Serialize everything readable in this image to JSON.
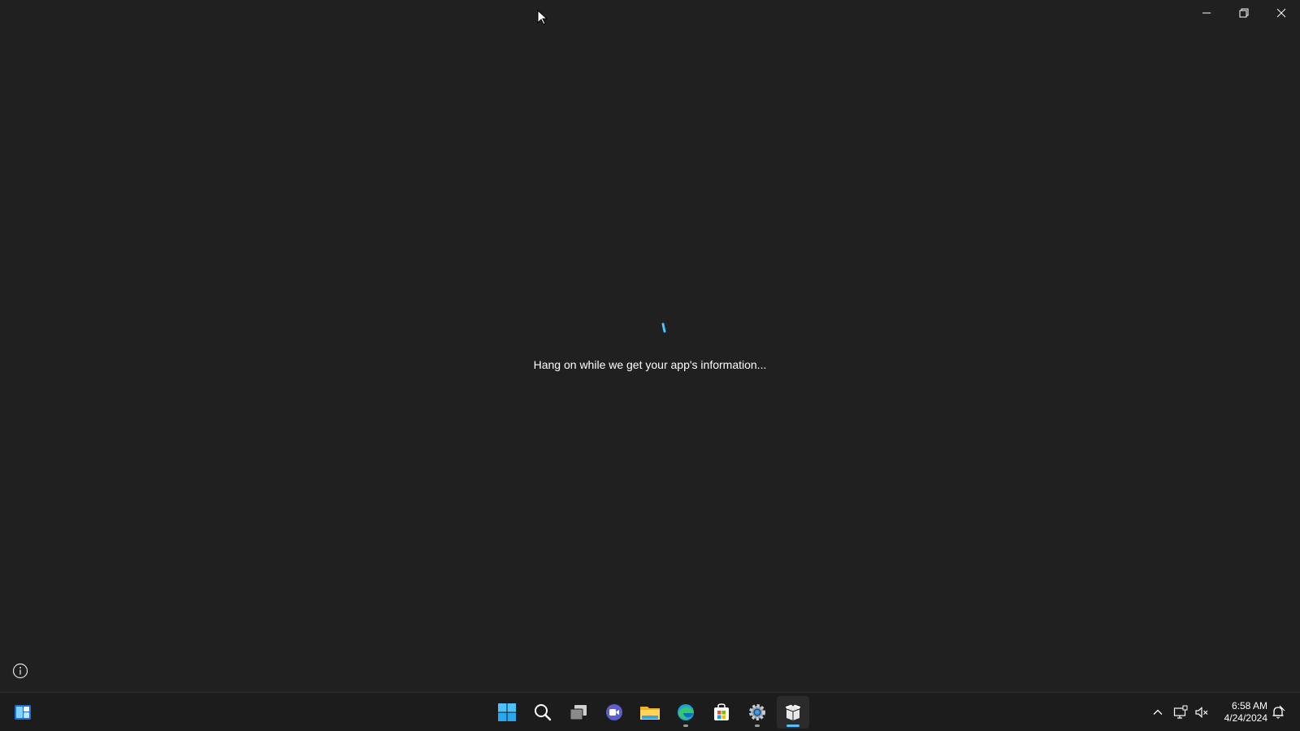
{
  "window": {
    "loading_message": "Hang on while we get your app's information...",
    "controls": [
      "minimize-icon",
      "restore-icon",
      "close-icon"
    ]
  },
  "taskbar": {
    "widgets_icon": "widgets-icon",
    "pinned": [
      {
        "name": "start",
        "icon": "windows-logo-icon",
        "running": false
      },
      {
        "name": "search",
        "icon": "search-icon",
        "running": false
      },
      {
        "name": "task-view",
        "icon": "task-view-icon",
        "running": false
      },
      {
        "name": "chat",
        "icon": "chat-icon",
        "running": false
      },
      {
        "name": "file-explorer",
        "icon": "folder-icon",
        "running": false
      },
      {
        "name": "edge",
        "icon": "edge-icon",
        "running": true
      },
      {
        "name": "store",
        "icon": "store-icon",
        "running": false
      },
      {
        "name": "settings",
        "icon": "gear-icon",
        "running": true
      },
      {
        "name": "app-installer",
        "icon": "package-icon",
        "running": true,
        "focused": true
      }
    ],
    "tray": {
      "chevron": "chevron-up-icon",
      "network": "network-icon",
      "volume": "volume-muted-icon",
      "notifications": "notification-icon"
    },
    "clock": {
      "time": "6:58 AM",
      "date": "4/24/2024"
    }
  },
  "colors": {
    "background": "#202020",
    "taskbar": "#1c1c1c",
    "accent": "#4cc2ff"
  }
}
